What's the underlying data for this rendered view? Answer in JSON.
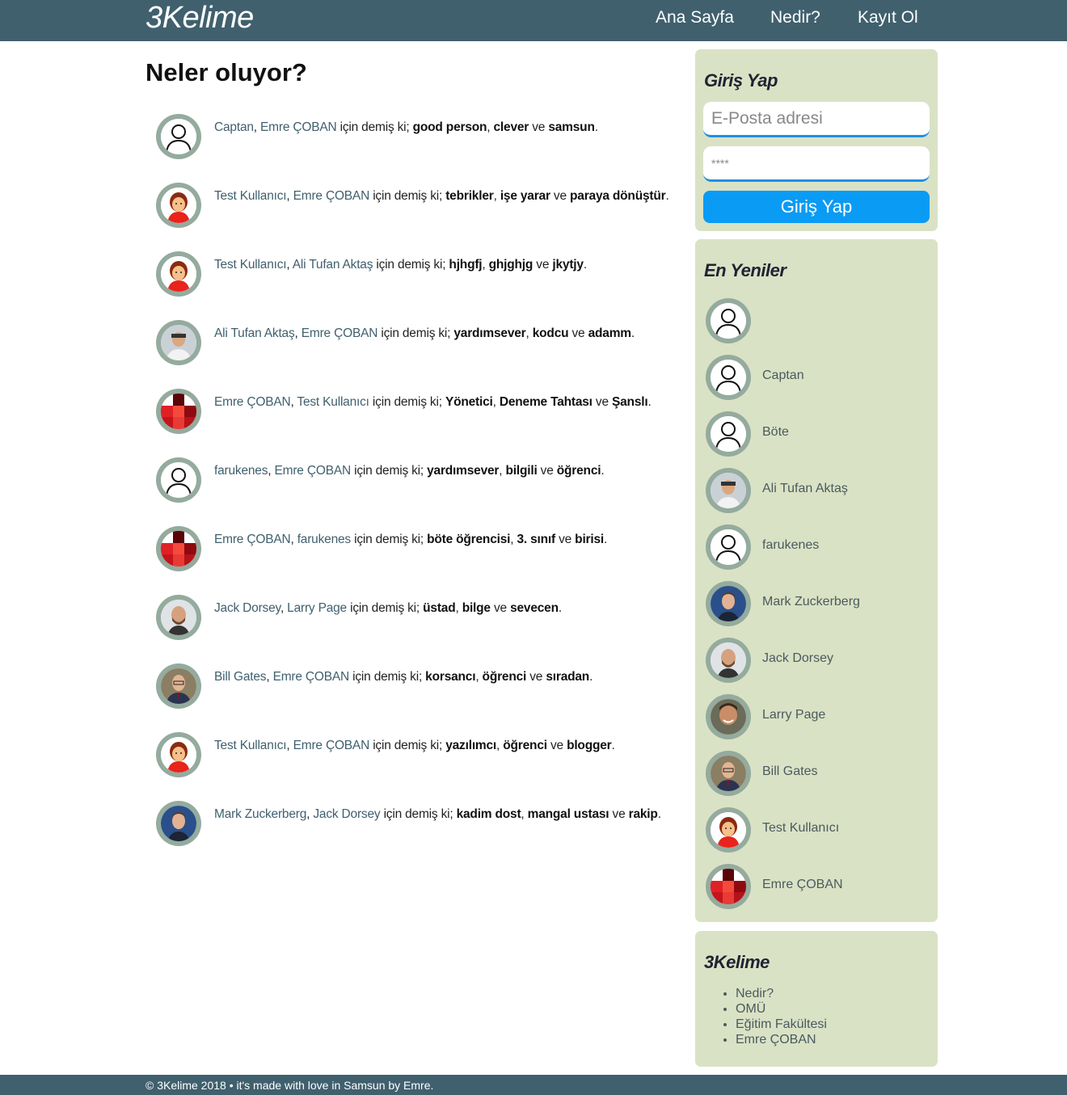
{
  "header": {
    "logo": "3Kelime",
    "nav": [
      "Ana Sayfa",
      "Nedir?",
      "Kayıt Ol"
    ]
  },
  "main": {
    "title": "Neler oluyor?",
    "connector": "için demiş ki;",
    "and_word": "ve",
    "feed": [
      {
        "from": "Captan",
        "to": "Emre ÇOBAN",
        "words": [
          "good person",
          "clever",
          "samsun"
        ],
        "avatar": "default"
      },
      {
        "from": "Test Kullanıcı",
        "to": "Emre ÇOBAN",
        "words": [
          "tebrikler",
          "işe yarar",
          "paraya dönüştür"
        ],
        "avatar": "girl"
      },
      {
        "from": "Test Kullanıcı",
        "to": "Ali Tufan Aktaş",
        "words": [
          "hjhgfj",
          "ghjghjg",
          "jkytjy"
        ],
        "avatar": "girl"
      },
      {
        "from": "Ali Tufan Aktaş",
        "to": "Emre ÇOBAN",
        "words": [
          "yardımsever",
          "kodcu",
          "adamm"
        ],
        "avatar": "photo-ali"
      },
      {
        "from": "Emre ÇOBAN",
        "to": "Test Kullanıcı",
        "words": [
          "Yönetici",
          "Deneme Tahtası",
          "Şanslı"
        ],
        "avatar": "pixel"
      },
      {
        "from": "farukenes",
        "to": "Emre ÇOBAN",
        "words": [
          "yardımsever",
          "bilgili",
          "öğrenci"
        ],
        "avatar": "default"
      },
      {
        "from": "Emre ÇOBAN",
        "to": "farukenes",
        "words": [
          "böte öğrencisi",
          "3. sınıf",
          "birisi"
        ],
        "avatar": "pixel"
      },
      {
        "from": "Jack Dorsey",
        "to": "Larry Page",
        "words": [
          "üstad",
          "bilge",
          "sevecen"
        ],
        "avatar": "photo-jack"
      },
      {
        "from": "Bill Gates",
        "to": "Emre ÇOBAN",
        "words": [
          "korsancı",
          "öğrenci",
          "sıradan"
        ],
        "avatar": "photo-bill"
      },
      {
        "from": "Test Kullanıcı",
        "to": "Emre ÇOBAN",
        "words": [
          "yazılımcı",
          "öğrenci",
          "blogger"
        ],
        "avatar": "girl"
      },
      {
        "from": "Mark Zuckerberg",
        "to": "Jack Dorsey",
        "words": [
          "kadim dost",
          "mangal ustası",
          "rakip"
        ],
        "avatar": "photo-mark"
      }
    ]
  },
  "login": {
    "title": "Giriş Yap",
    "email_placeholder": "E-Posta adresi",
    "password_value": "****",
    "button": "Giriş Yap"
  },
  "newest": {
    "title": "En Yeniler",
    "users": [
      {
        "name": "",
        "avatar": "default"
      },
      {
        "name": "Captan",
        "avatar": "default"
      },
      {
        "name": "Böte",
        "avatar": "default"
      },
      {
        "name": "Ali Tufan Aktaş",
        "avatar": "photo-ali"
      },
      {
        "name": "farukenes",
        "avatar": "default"
      },
      {
        "name": "Mark Zuckerberg",
        "avatar": "photo-mark"
      },
      {
        "name": "Jack Dorsey",
        "avatar": "photo-jack"
      },
      {
        "name": "Larry Page",
        "avatar": "photo-larry"
      },
      {
        "name": "Bill Gates",
        "avatar": "photo-bill"
      },
      {
        "name": "Test Kullanıcı",
        "avatar": "girl"
      },
      {
        "name": "Emre ÇOBAN",
        "avatar": "pixel"
      }
    ]
  },
  "about": {
    "title": "3Kelime",
    "links": [
      "Nedir?",
      "OMÜ",
      "Eğitim Fakültesi",
      "Emre ÇOBAN"
    ]
  },
  "footer": {
    "text": "© 3Kelime 2018 • it's made with love in Samsun by Emre."
  },
  "colors": {
    "topbar": "#40606e",
    "sidebar_panel": "#dae2c5",
    "login_button": "#0a9bf5",
    "avatar_ring": "#94ab9e"
  }
}
